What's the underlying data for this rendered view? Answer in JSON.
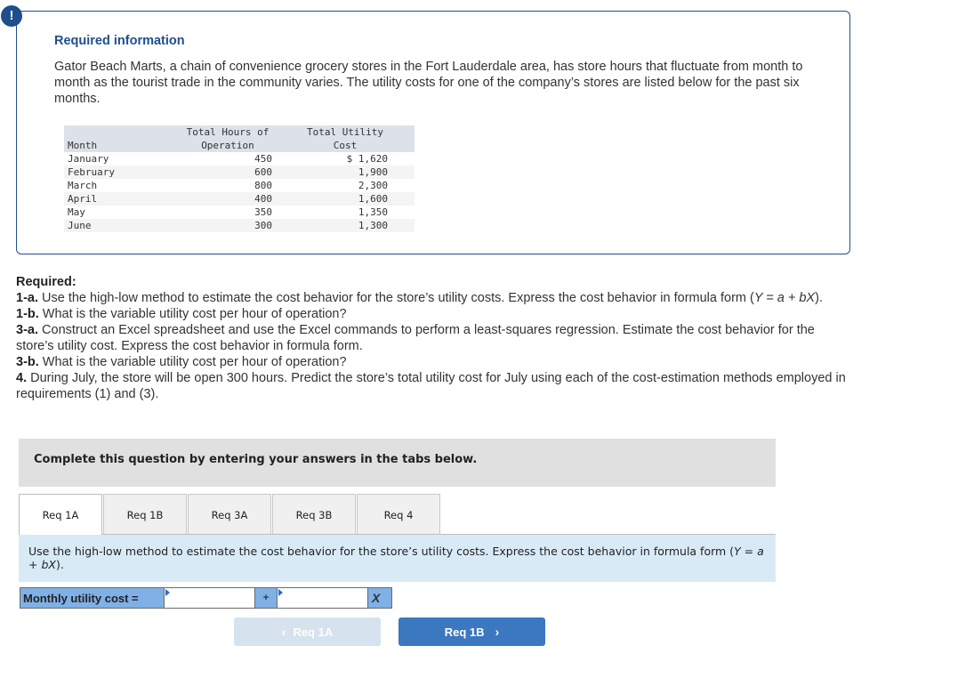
{
  "alert": {
    "icon": "!",
    "icon_name": "exclamation-icon"
  },
  "info": {
    "title": "Required information",
    "description": "Gator Beach Marts, a chain of convenience grocery stores in the Fort Lauderdale area, has store hours that fluctuate from month to month as the tourist trade in the community varies. The utility costs for one of the company’s stores are listed below for the past six months."
  },
  "table": {
    "headers": {
      "month": "Month",
      "hours_line1": "Total Hours of",
      "hours_line2": "Operation",
      "cost_line1": "Total Utility",
      "cost_line2": "Cost"
    },
    "rows": [
      {
        "month": "January",
        "hours": "450",
        "cost": "$ 1,620"
      },
      {
        "month": "February",
        "hours": "600",
        "cost": "1,900"
      },
      {
        "month": "March",
        "hours": "800",
        "cost": "2,300"
      },
      {
        "month": "April",
        "hours": "400",
        "cost": "1,600"
      },
      {
        "month": "May",
        "hours": "350",
        "cost": "1,350"
      },
      {
        "month": "June",
        "hours": "300",
        "cost": "1,300"
      }
    ]
  },
  "required": {
    "heading": "Required:",
    "items": [
      {
        "label": "1-a.",
        "text": " Use the high-low method to estimate the cost behavior for the store’s utility costs. Express the cost behavior in formula form (",
        "formula": "Y = a + bX",
        "suffix": ")."
      },
      {
        "label": "1-b.",
        "text": " What is the variable utility cost per hour of operation?"
      },
      {
        "label": "3-a.",
        "text": " Construct an Excel spreadsheet and use the Excel commands to perform a least-squares regression. Estimate the cost behavior for the store’s utility cost. Express the cost behavior in formula form."
      },
      {
        "label": "3-b.",
        "text": " What is the variable utility cost per hour of operation?"
      },
      {
        "label": "4.",
        "text": " During July, the store will be open 300 hours. Predict the store’s total utility cost for July using each of the cost-estimation methods employed in requirements (1) and (3)."
      }
    ]
  },
  "banner": {
    "text": "Complete this question by entering your answers in the tabs below."
  },
  "tabs": [
    {
      "label": "Req 1A",
      "active": true
    },
    {
      "label": "Req 1B",
      "active": false
    },
    {
      "label": "Req 3A",
      "active": false
    },
    {
      "label": "Req 3B",
      "active": false
    },
    {
      "label": "Req 4",
      "active": false
    }
  ],
  "question": {
    "text": "Use the high-low method to estimate the cost behavior for the store’s utility costs. Express the cost behavior in formula form (",
    "formula": "Y = a + bX",
    "suffix": ")."
  },
  "formula_row": {
    "label": "Monthly utility cost =",
    "input_a_value": "",
    "plus": "+",
    "input_b_value": "",
    "x_label": "X"
  },
  "nav": {
    "prev_label": "Req 1A",
    "prev_icon": "‹",
    "next_label": "Req 1B",
    "next_icon": "›"
  },
  "colors": {
    "brand_blue": "#1f4e8c",
    "label_blue": "#7fb0e6",
    "question_bg": "#d9eaf7",
    "next_button": "#3b78c0",
    "prev_button_disabled": "#d6e2ee"
  }
}
